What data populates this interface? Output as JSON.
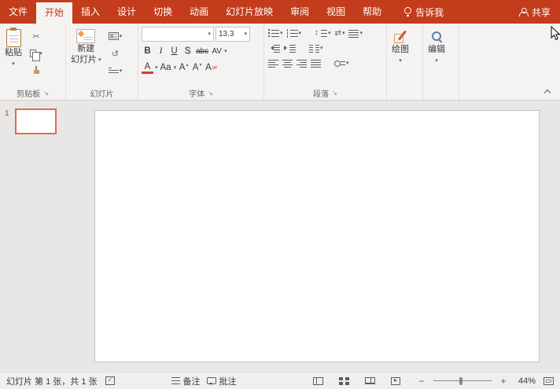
{
  "colors": {
    "brand_red": "#C33C1B",
    "slide_selection_border": "#E26B4E",
    "font_color_indicator": "#D83B2D"
  },
  "menu": {
    "tabs": [
      {
        "label": "文件"
      },
      {
        "label": "开始",
        "active": true
      },
      {
        "label": "插入"
      },
      {
        "label": "设计"
      },
      {
        "label": "切换"
      },
      {
        "label": "动画"
      },
      {
        "label": "幻灯片放映"
      },
      {
        "label": "审阅"
      },
      {
        "label": "视图"
      },
      {
        "label": "帮助"
      }
    ],
    "tell_me": "告诉我",
    "share": "共享"
  },
  "ribbon": {
    "clipboard": {
      "group_label": "剪贴板",
      "paste": "粘贴"
    },
    "slides": {
      "group_label": "幻灯片",
      "new_slide_line1": "新建",
      "new_slide_line2": "幻灯片"
    },
    "font": {
      "group_label": "字体",
      "name_value": "",
      "size_value": "13.3",
      "bold": "B",
      "italic": "I",
      "underline": "U",
      "shadow": "S",
      "strikethrough": "abc",
      "spacing": "AV",
      "color_a": "A",
      "case": "Aa",
      "grow_a": "A",
      "shrink_a": "A",
      "clear_a": "A"
    },
    "paragraph": {
      "group_label": "段落"
    },
    "drawing": {
      "button_label": "绘图"
    },
    "editing": {
      "button_label": "编辑"
    }
  },
  "slide_panel": {
    "slide_number": "1"
  },
  "statusbar": {
    "slide_info": "幻灯片 第 1 张，共 1 张",
    "notes": "备注",
    "comments": "批注",
    "zoom_out": "−",
    "zoom_in": "+",
    "zoom_percent": "44%"
  },
  "icons": {
    "cut": "✂",
    "dialog_launcher": "↘",
    "reset": "↺",
    "direction": "⇄",
    "dropdown": "▾"
  }
}
